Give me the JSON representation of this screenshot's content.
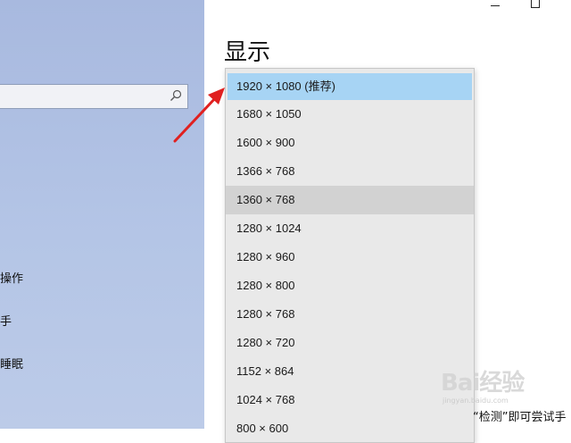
{
  "sidebar": {
    "search": {
      "value": "",
      "icon": "search-icon"
    },
    "items": [
      {
        "label": "操作"
      },
      {
        "label": "手"
      },
      {
        "label": "睡眠"
      }
    ]
  },
  "window_controls": {
    "minimize_icon": "minimize-icon",
    "maximize_icon": "maximize-icon"
  },
  "main": {
    "title": "显示",
    "resolution_dropdown": {
      "selected": "1920 × 1080 (推荐)",
      "options": [
        "1920 × 1080 (推荐)",
        "1680 × 1050",
        "1600 × 900",
        "1366 × 768",
        "1360 × 768",
        "1280 × 1024",
        "1280 × 960",
        "1280 × 800",
        "1280 × 768",
        "1280 × 720",
        "1152 × 864",
        "1024 × 768",
        "800 × 600"
      ],
      "hovered_option": "1360 × 768"
    },
    "hint_text": "“检测”即可尝试手"
  },
  "annotation": {
    "arrow_color": "#e02020"
  },
  "watermark": {
    "logo": "Bai经验",
    "sub": "jingyan.baidu.com"
  }
}
